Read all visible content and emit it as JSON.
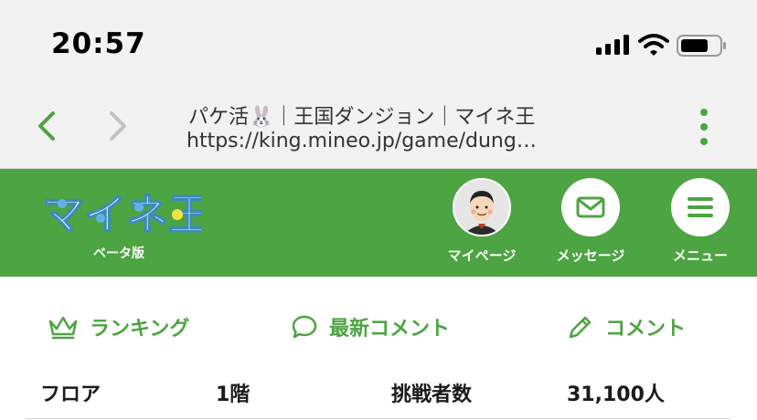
{
  "status": {
    "time": "20:57"
  },
  "browser": {
    "title": "パケ活🐰｜王国ダンジョン｜マイネ王",
    "url": "https://king.mineo.jp/game/dung…"
  },
  "header": {
    "logo_text": "マイネ王",
    "beta_label": "ベータ版",
    "buttons": [
      {
        "label": "マイページ",
        "icon": "avatar"
      },
      {
        "label": "メッセージ",
        "icon": "envelope-icon"
      },
      {
        "label": "メニュー",
        "icon": "hamburger-icon"
      }
    ]
  },
  "actions": [
    {
      "label": "ランキング",
      "icon": "crown-icon"
    },
    {
      "label": "最新コメント",
      "icon": "speech-bubble-icon"
    },
    {
      "label": "コメント",
      "icon": "pencil-icon"
    }
  ],
  "info": {
    "floor_label": "フロア",
    "floor_value": "1階",
    "challengers_label": "挑戦者数",
    "challengers_value": "31,100人"
  },
  "colors": {
    "brand_green": "#4da442",
    "bar_gray": "#f2f2f2"
  }
}
